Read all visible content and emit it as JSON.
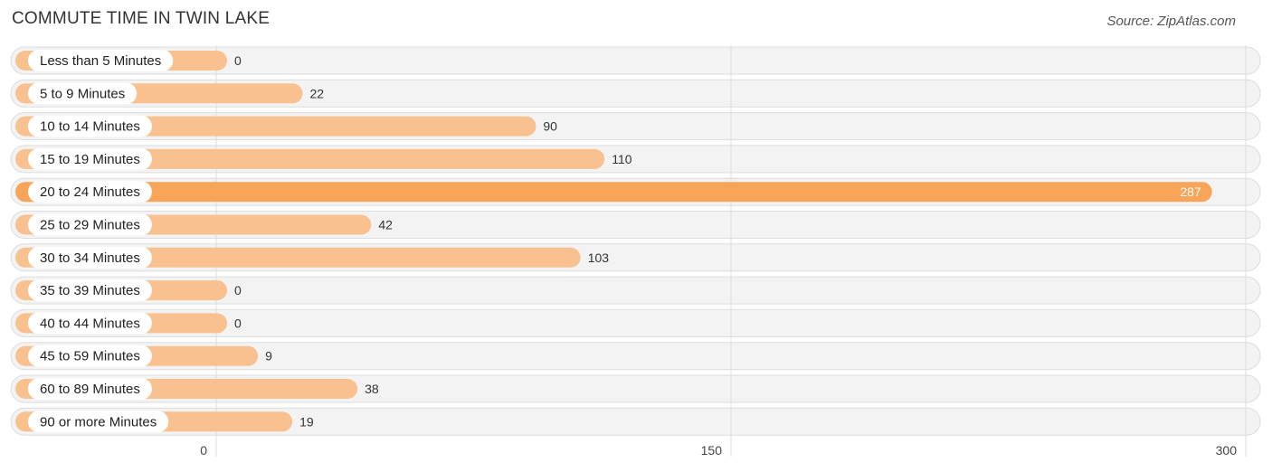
{
  "header": {
    "title": "COMMUTE TIME IN TWIN LAKE",
    "source": "Source: ZipAtlas.com"
  },
  "colors": {
    "bar": "#f9c18f",
    "bar_highlight": "#f8a55a",
    "track": "#f3f3f3",
    "grid": "#dddddd"
  },
  "chart_data": {
    "type": "bar",
    "orientation": "horizontal",
    "title": "COMMUTE TIME IN TWIN LAKE",
    "xlabel": "",
    "ylabel": "",
    "categories": [
      "Less than 5 Minutes",
      "5 to 9 Minutes",
      "10 to 14 Minutes",
      "15 to 19 Minutes",
      "20 to 24 Minutes",
      "25 to 29 Minutes",
      "30 to 34 Minutes",
      "35 to 39 Minutes",
      "40 to 44 Minutes",
      "45 to 59 Minutes",
      "60 to 89 Minutes",
      "90 or more Minutes"
    ],
    "values": [
      0,
      22,
      90,
      110,
      287,
      42,
      103,
      0,
      0,
      9,
      38,
      19
    ],
    "value_labels": [
      "0",
      "22",
      "90",
      "110",
      "287",
      "42",
      "103",
      "0",
      "0",
      "9",
      "38",
      "19"
    ],
    "highlight_index": 4,
    "xlim": [
      0,
      300
    ],
    "xticks": [
      0,
      150,
      300
    ],
    "xtick_labels": [
      "0",
      "150",
      "300"
    ],
    "grid": true,
    "legend": "none"
  }
}
